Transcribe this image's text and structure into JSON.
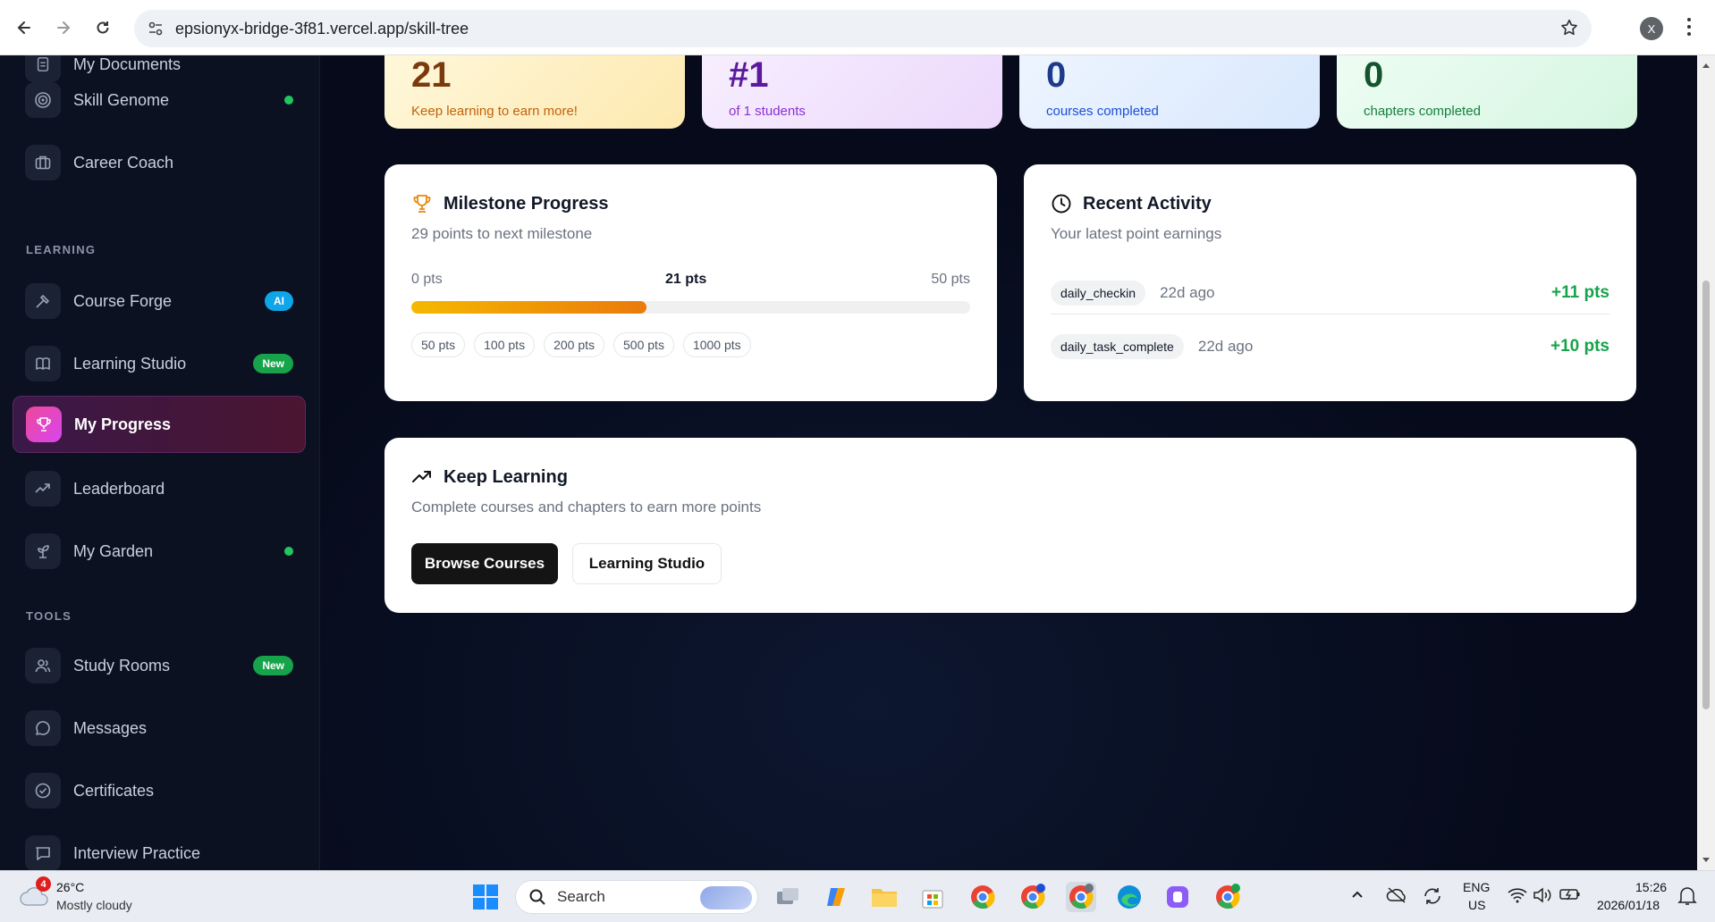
{
  "browser": {
    "url": "epsionyx-bridge-3f81.vercel.app/skill-tree",
    "profile_initial": "X"
  },
  "sidebar": {
    "items_top": [
      {
        "label": "My Documents"
      },
      {
        "label": "Skill Genome",
        "dot": true
      },
      {
        "label": "Career Coach"
      }
    ],
    "section_learning": "LEARNING",
    "items_learning": [
      {
        "label": "Course Forge",
        "badge": "AI"
      },
      {
        "label": "Learning Studio",
        "badge": "New"
      },
      {
        "label": "My Progress",
        "active": true
      },
      {
        "label": "Leaderboard"
      },
      {
        "label": "My Garden",
        "dot": true
      }
    ],
    "section_tools": "TOOLS",
    "items_tools": [
      {
        "label": "Study Rooms",
        "badge": "New"
      },
      {
        "label": "Messages"
      },
      {
        "label": "Certificates"
      },
      {
        "label": "Interview Practice"
      }
    ]
  },
  "stats": [
    {
      "value": "21",
      "sub": "Keep learning to earn more!"
    },
    {
      "value": "#1",
      "sub": "of 1 students"
    },
    {
      "value": "0",
      "sub": "courses completed"
    },
    {
      "value": "0",
      "sub": "chapters completed"
    }
  ],
  "milestone": {
    "title": "Milestone Progress",
    "subtitle": "29 points to next milestone",
    "min_label": "0 pts",
    "current_label": "21 pts",
    "max_label": "50 pts",
    "progress_fraction": 0.42,
    "milestones": [
      "50 pts",
      "100 pts",
      "200 pts",
      "500 pts",
      "1000 pts"
    ]
  },
  "activity": {
    "title": "Recent Activity",
    "subtitle": "Your latest point earnings",
    "items": [
      {
        "tag": "daily_checkin",
        "time": "22d ago",
        "points": "+11 pts"
      },
      {
        "tag": "daily_task_complete",
        "time": "22d ago",
        "points": "+10 pts"
      }
    ]
  },
  "keep_learning": {
    "title": "Keep Learning",
    "subtitle": "Complete courses and chapters to earn more points",
    "browse_label": "Browse Courses",
    "studio_label": "Learning Studio"
  },
  "taskbar": {
    "weather_temp": "26°C",
    "weather_desc": "Mostly cloudy",
    "weather_badge": "4",
    "search_label": "Search",
    "lang_top": "ENG",
    "lang_bottom": "US",
    "time": "15:26",
    "date": "2026/01/18"
  },
  "colors": {
    "accent_pink": "#ec4899",
    "progress_start": "#f5b800",
    "progress_end": "#ea7a0c",
    "points_green": "#16a34a"
  }
}
